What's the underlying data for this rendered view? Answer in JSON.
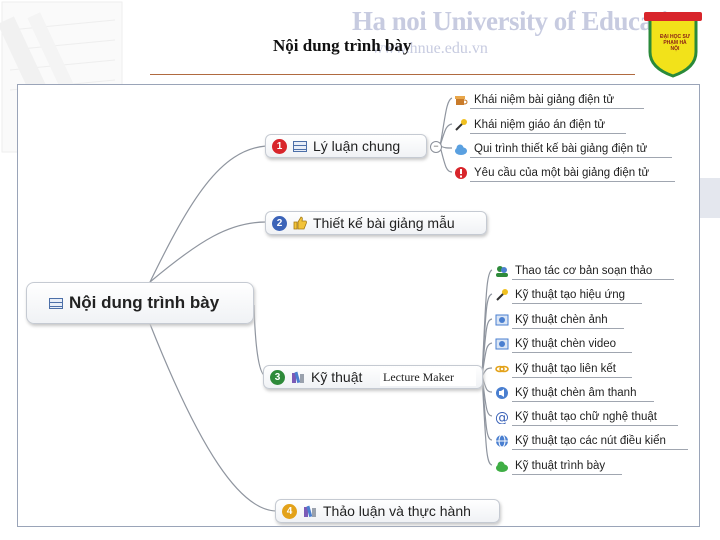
{
  "header": {
    "title": "Nội dung trình bày",
    "watermark": "Ha noi University of Education",
    "watermark_url": "www.hnue.edu.vn",
    "logo_text": "ĐẠI HỌC SƯ PHẠM HÀ NỘI"
  },
  "mindmap": {
    "central": "Nội dung trình bày",
    "branches": [
      {
        "number": "1",
        "label": "Lý luận chung",
        "color": "#d8252b",
        "leaves": [
          "Khái niệm bài giảng điện tử",
          "Khái niệm giáo án điện tử",
          "Qui trình thiết kế bài giảng điện tử",
          "Yêu cầu của một bài giảng điện tử"
        ]
      },
      {
        "number": "2",
        "label": "Thiết kế bài giảng mẫu",
        "color": "#3b63b8",
        "leaves": []
      },
      {
        "number": "3",
        "label": "Kỹ thuật",
        "color": "#2e8a3a",
        "leaves": [
          "Thao tác cơ bản soạn thảo",
          "Kỹ thuật tạo hiệu ứng",
          "Kỹ thuật chèn ảnh",
          "Kỹ thuật chèn video",
          "Kỹ thuật tạo liên kết",
          "Kỹ thuật chèn âm thanh",
          "Kỹ thuật tạo chữ nghệ thuật",
          "Kỹ thuật tạo các nút điều kiển",
          "Kỹ thuật trình bày"
        ]
      },
      {
        "number": "4",
        "label": "Thảo luận và thực hành",
        "color": "#e3a21a",
        "leaves": []
      }
    ],
    "caption": "Lecture Maker"
  }
}
